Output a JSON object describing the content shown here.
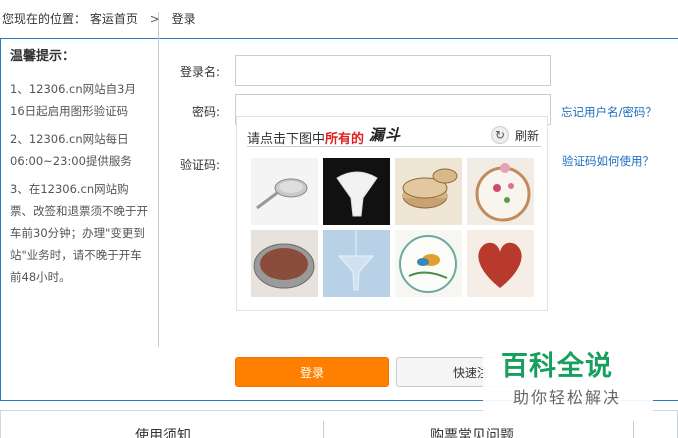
{
  "breadcrumb": {
    "prefix": "您现在的位置：",
    "home": "客运首页",
    "sep": ">",
    "current": "登录"
  },
  "tips": {
    "title": "温馨提示：",
    "items": [
      "1、12306.cn网站自3月16日起启用图形验证码",
      "2、12306.cn网站每日06:00~23:00提供服务",
      "3、在12306.cn网站购票、改签和退票须不晚于开车前30分钟；办理\"变更到站\"业务时，请不晚于开车前48小时。"
    ]
  },
  "form": {
    "username_label": "登录名:",
    "username_value": "",
    "password_label": "密码:",
    "password_value": "",
    "captcha_label": "验证码:",
    "forgot_link": "忘记用户名/密码？",
    "captcha_help_link": "验证码如何使用？"
  },
  "captcha": {
    "prompt_before": "请点击下图中",
    "prompt_highlight": "所有的",
    "target_word": "漏斗",
    "refresh_label": "刷新",
    "images": [
      "sieve-spoon",
      "white-funnel",
      "bamboo-steamer",
      "embroidery-hoop",
      "rice-bowl",
      "glass-funnel",
      "bird-embroidery",
      "red-beans-heart"
    ]
  },
  "buttons": {
    "login": "登录",
    "quick": "快速注"
  },
  "bottom_tabs": {
    "left": "使用须知",
    "right": "购票常见问题"
  },
  "watermark": {
    "title": "百科全说",
    "subtitle": "助你轻松解决"
  },
  "colors": {
    "accent": "#2a7bc4",
    "login_button": "#ff8000",
    "link": "#1a6cc0",
    "highlight": "#e02020",
    "watermark": "#17a05d"
  }
}
